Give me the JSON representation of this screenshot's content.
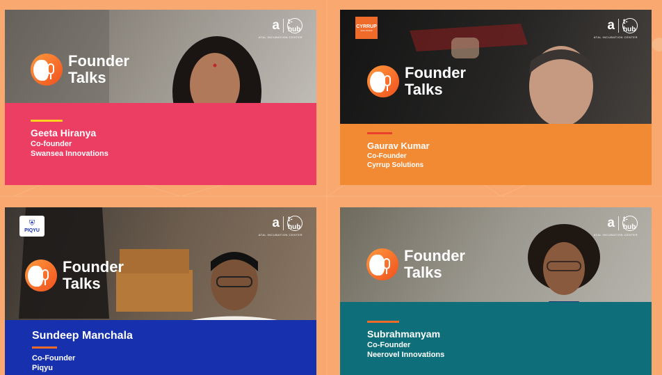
{
  "colors": {
    "page_bg": "#f9a970",
    "logo_gradient_start": "#ff9a3d",
    "logo_gradient_end": "#f0501e"
  },
  "cards": [
    {
      "brand": {
        "line1": "Founder",
        "line2": "Talks"
      },
      "incubator": {
        "name": "ATAL INCUBATION CENTER",
        "partner": "t-hub"
      },
      "name": "Geeta Hiranya",
      "role": "Co-founder",
      "company": "Swansea Innovations",
      "band_color": "#ec3d63",
      "accent_color": "#ffd21f"
    },
    {
      "brand": {
        "line1": "Founder",
        "line2": "Talks"
      },
      "incubator": {
        "name": "ATAL INCUBATION CENTER",
        "partner": "t-hub"
      },
      "partner_logo": {
        "text": "CYRRUP",
        "sub": "SOLUTIONS"
      },
      "name": "Gaurav Kumar",
      "role": "Co-Founder",
      "company": "Cyrrup Solutions",
      "band_color": "#f28a33",
      "accent_color": "#e8402b"
    },
    {
      "brand": {
        "line1": "Founder",
        "line2": "Talks"
      },
      "incubator": {
        "name": "ATAL INCUBATION CENTER",
        "partner": "t-hub"
      },
      "partner_logo": {
        "text": "PIQYU"
      },
      "name": "Sundeep Manchala",
      "role": "Co-Founder",
      "company": "Piqyu",
      "band_color": "#1730ad",
      "accent_color": "#f06a2a"
    },
    {
      "brand": {
        "line1": "Founder",
        "line2": "Talks"
      },
      "incubator": {
        "name": "ATAL INCUBATION CENTER",
        "partner": "t-hub"
      },
      "name": "Subrahmanyam",
      "role": "Co-Founder",
      "company": "Neerovel Innovations",
      "band_color": "#0e6f7b",
      "accent_color": "#f06a2a"
    }
  ]
}
